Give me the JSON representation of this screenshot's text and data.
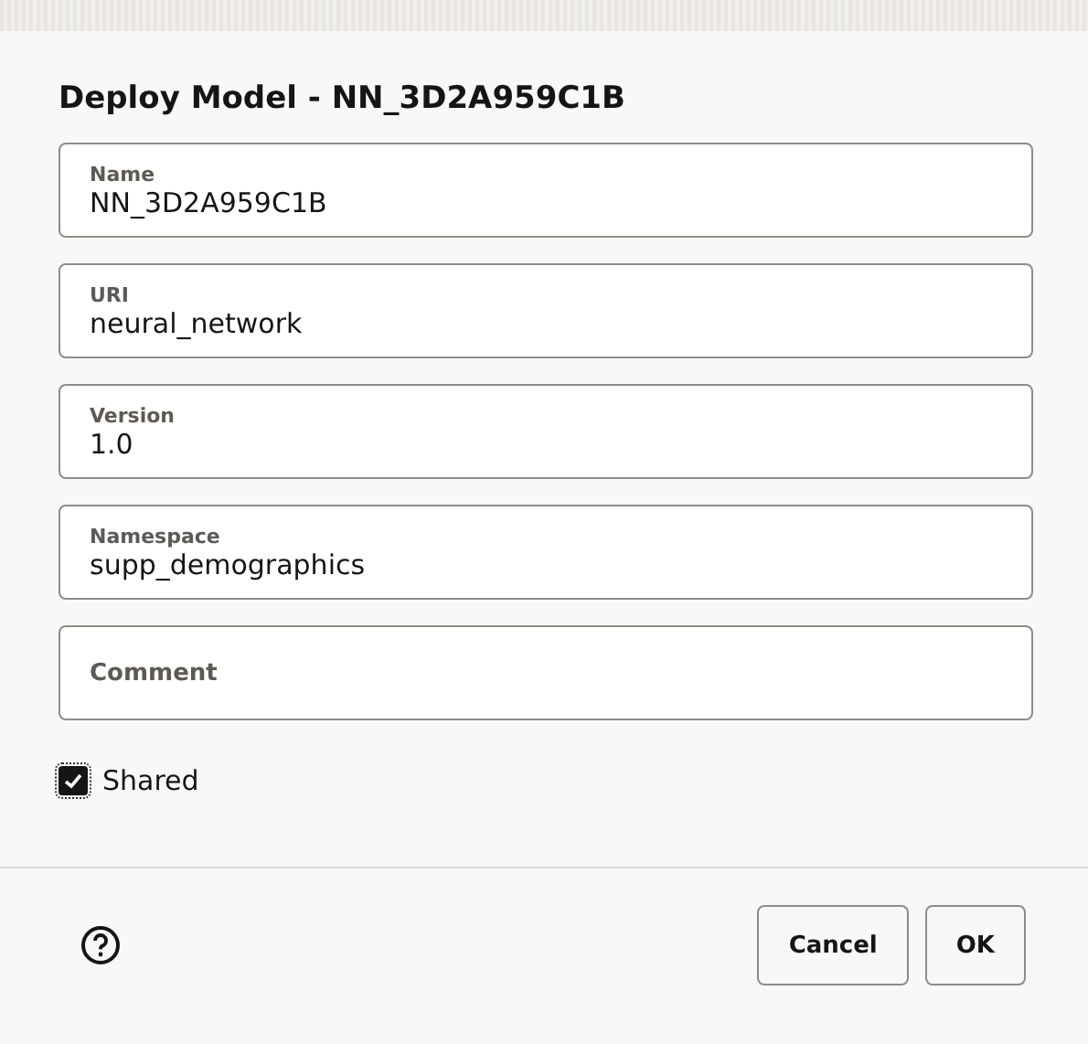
{
  "dialog": {
    "title": "Deploy Model - NN_3D2A959C1B"
  },
  "fields": [
    {
      "label": "Name",
      "value": "NN_3D2A959C1B"
    },
    {
      "label": "URI",
      "value": "neural_network"
    },
    {
      "label": "Version",
      "value": "1.0"
    },
    {
      "label": "Namespace",
      "value": "supp_demographics"
    },
    {
      "label": "Comment"
    }
  ],
  "shared": {
    "label": "Shared",
    "checked": true
  },
  "buttons": [
    {
      "label": "Cancel"
    },
    {
      "label": "OK"
    }
  ]
}
